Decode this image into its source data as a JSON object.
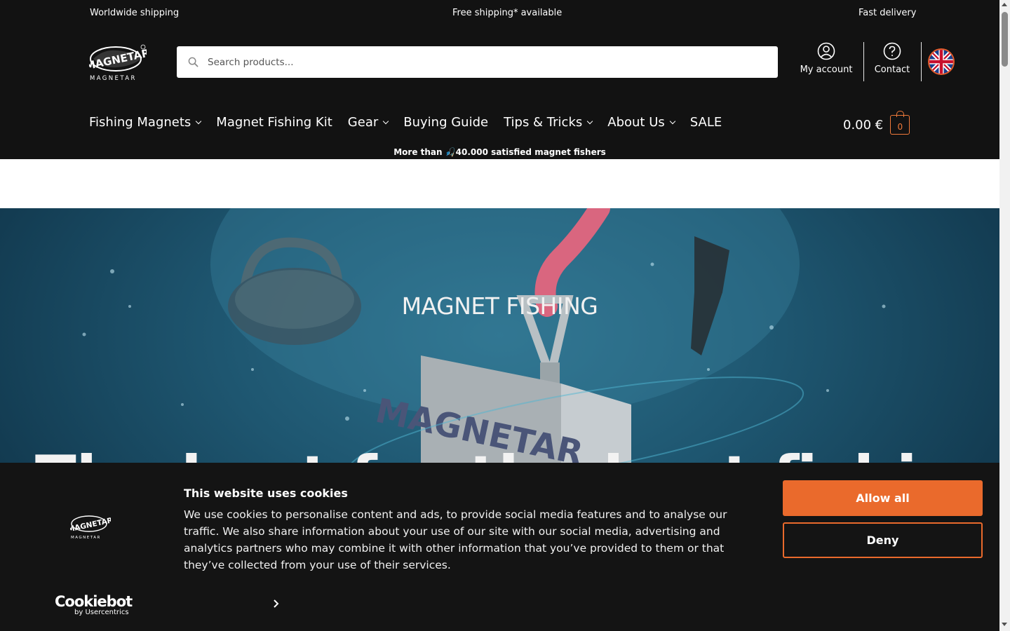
{
  "topbar": {
    "left": "Worldwide shipping",
    "center": "Free shipping* available",
    "right": "Fast delivery"
  },
  "header": {
    "logo_text": "MAGNETAR",
    "search_placeholder": "Search products...",
    "account_label": "My account",
    "contact_label": "Contact",
    "language": "English (UK flag)"
  },
  "nav": {
    "items": [
      {
        "label": "Fishing Magnets",
        "dropdown": true
      },
      {
        "label": "Magnet Fishing Kit",
        "dropdown": false
      },
      {
        "label": "Gear",
        "dropdown": true
      },
      {
        "label": "Buying Guide",
        "dropdown": false
      },
      {
        "label": "Tips & Tricks",
        "dropdown": true
      },
      {
        "label": "About Us",
        "dropdown": true
      },
      {
        "label": "SALE",
        "dropdown": false
      }
    ],
    "cart_total": "0.00 €",
    "cart_count": "0"
  },
  "tagline": "More than 🎣40.000 satisfied magnet fishers",
  "hero": {
    "title": "MAGNET FISHING",
    "subtitle_partial": "The best for the best fishing nee d"
  },
  "cookie": {
    "logo_text": "MAGNETAR",
    "title": "This website uses cookies",
    "text": "We use cookies to personalise content and ads, to provide social media features and to analyse our traffic. We also share information about your use of our site with our social media, advertising and analytics partners who may combine it with other information that you’ve provided to them or that they’ve collected from your use of their services.",
    "allow_label": "Allow all",
    "deny_label": "Deny",
    "brand": "Cookiebot",
    "brand_sub": "by Usercentrics"
  },
  "colors": {
    "accent": "#ea6a2c",
    "header_bg": "#121212",
    "cookie_bg": "#141414"
  }
}
